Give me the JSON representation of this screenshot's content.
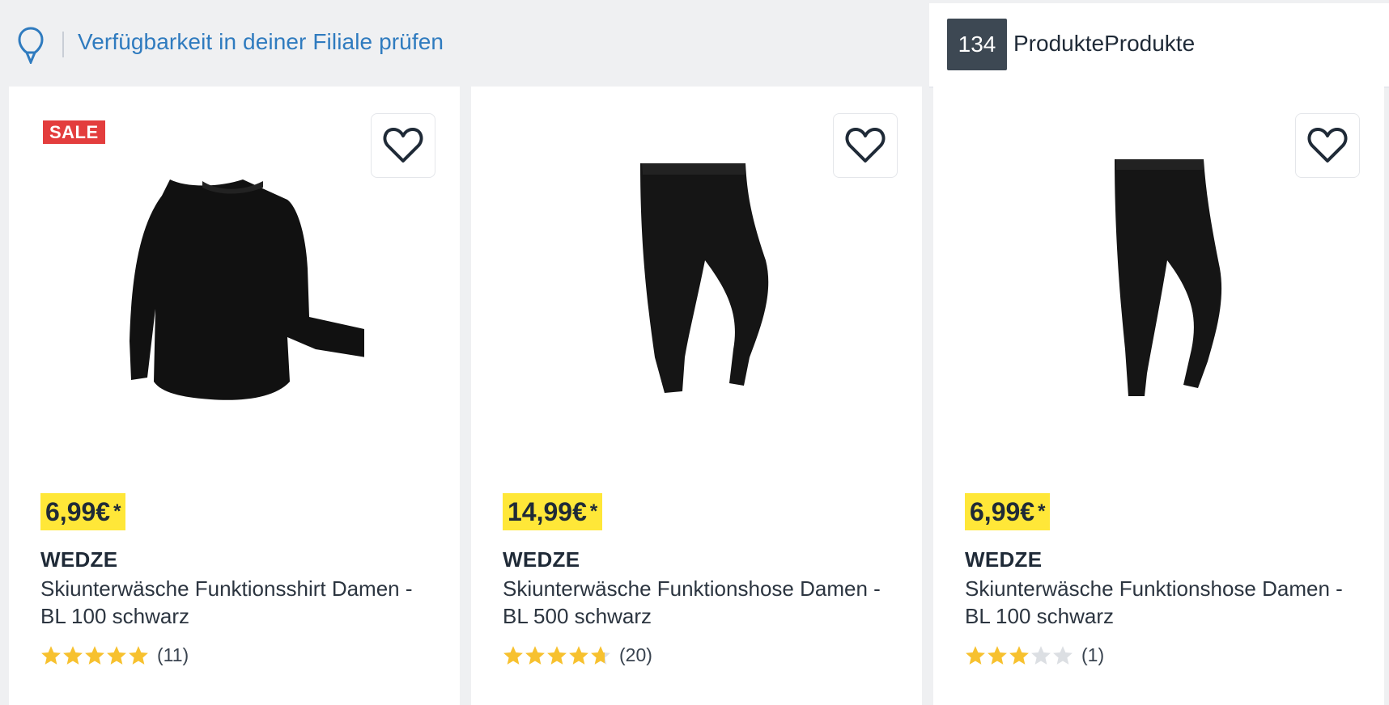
{
  "header": {
    "store_check_label": "Verfügbarkeit in deiner Filiale prüfen",
    "product_count": "134",
    "product_count_label": "ProdukteProdukte"
  },
  "colors": {
    "price_highlight": "#ffe738",
    "sale_badge": "#e33d3d",
    "link": "#2f7bbf",
    "star_filled": "#f7c12f",
    "star_empty": "#dcdfe3"
  },
  "products": [
    {
      "badge": "SALE",
      "price": "6,99€",
      "price_suffix": "*",
      "brand": "WEDZE",
      "title": "Skiunterwäsche Funktionsshirt Damen - BL 100 schwarz",
      "rating": 5,
      "reviews": "(11)",
      "image_icon": "black-thermal-shirt",
      "favorite_icon": "heart-icon"
    },
    {
      "badge": "",
      "price": "14,99€",
      "price_suffix": "*",
      "brand": "WEDZE",
      "title": "Skiunterwäsche Funktionshose Damen - BL 500 schwarz",
      "rating": 4.7,
      "reviews": "(20)",
      "image_icon": "black-leggings",
      "favorite_icon": "heart-icon"
    },
    {
      "badge": "",
      "price": "6,99€",
      "price_suffix": "*",
      "brand": "WEDZE",
      "title": "Skiunterwäsche Funktionshose Damen - BL 100 schwarz",
      "rating": 3,
      "reviews": "(1)",
      "image_icon": "black-leggings",
      "favorite_icon": "heart-icon"
    }
  ]
}
